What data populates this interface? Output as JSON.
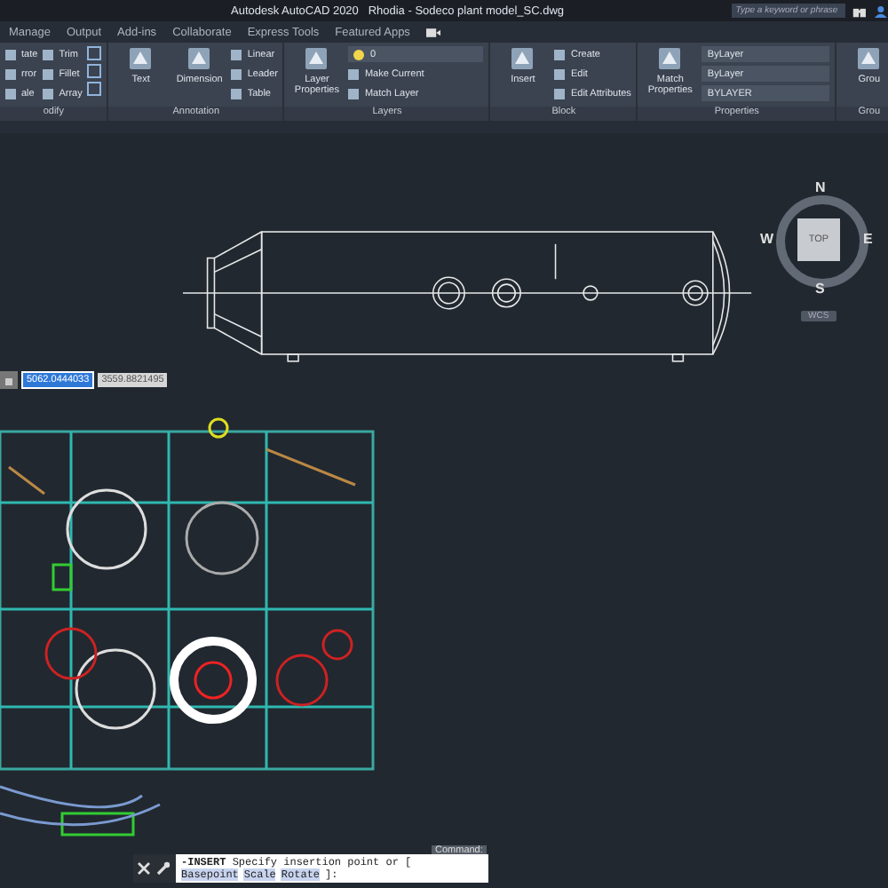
{
  "title_bar": {
    "app": "Autodesk AutoCAD 2020",
    "document": "Rhodia - Sodeco plant model_SC.dwg",
    "search": {
      "placeholder": "Type a keyword or phrase"
    }
  },
  "ribbon_tabs": [
    {
      "label": "Manage",
      "selected": false
    },
    {
      "label": "Output",
      "selected": false
    },
    {
      "label": "Add-ins",
      "selected": false
    },
    {
      "label": "Collaborate",
      "selected": false
    },
    {
      "label": "Express Tools",
      "selected": false
    },
    {
      "label": "Featured Apps",
      "selected": false
    }
  ],
  "ribbon_panels": [
    {
      "title": "odify",
      "columns": [
        {
          "kind": "stack",
          "items": [
            "tate",
            "rror",
            "ale"
          ]
        },
        {
          "kind": "stack",
          "items": [
            "Trim",
            "Fillet",
            "Array"
          ]
        },
        {
          "kind": "icons"
        }
      ]
    },
    {
      "title": "Annotation",
      "columns": [
        {
          "kind": "large",
          "label": "Text"
        },
        {
          "kind": "large",
          "label": "Dimension"
        },
        {
          "kind": "stack",
          "items": [
            "Linear",
            "Leader",
            "Table"
          ]
        }
      ]
    },
    {
      "title": "Layers",
      "columns": [
        {
          "kind": "large",
          "label": "Layer Properties"
        },
        {
          "kind": "layers",
          "value": "0",
          "items": [
            "Make Current",
            "Match Layer"
          ]
        }
      ]
    },
    {
      "title": "Block",
      "columns": [
        {
          "kind": "large",
          "label": "Insert"
        },
        {
          "kind": "stack",
          "items": [
            "Create",
            "Edit",
            "Edit Attributes"
          ]
        }
      ]
    },
    {
      "title": "Properties",
      "columns": [
        {
          "kind": "large",
          "label": "Match Properties"
        },
        {
          "kind": "fields",
          "items": [
            "ByLayer",
            "ByLayer",
            "BYLAYER"
          ]
        }
      ]
    },
    {
      "title": "Grou",
      "columns": [
        {
          "kind": "large",
          "label": "Grou"
        }
      ]
    }
  ],
  "viewcube": {
    "face": "TOP",
    "north": "N",
    "east": "E",
    "south": "S",
    "west": "W",
    "ucs": "WCS"
  },
  "coordinate_input": [
    {
      "value": "5062.0444033",
      "selected": true
    },
    {
      "value": "3559.8821495",
      "selected": false
    }
  ],
  "command_line": {
    "label": "Command:",
    "prompt": "**-INSERT** Specify insertion point or [",
    "options": [
      "Basepoint",
      "Scale",
      "Rotate"
    ],
    "suffix": "]:"
  }
}
